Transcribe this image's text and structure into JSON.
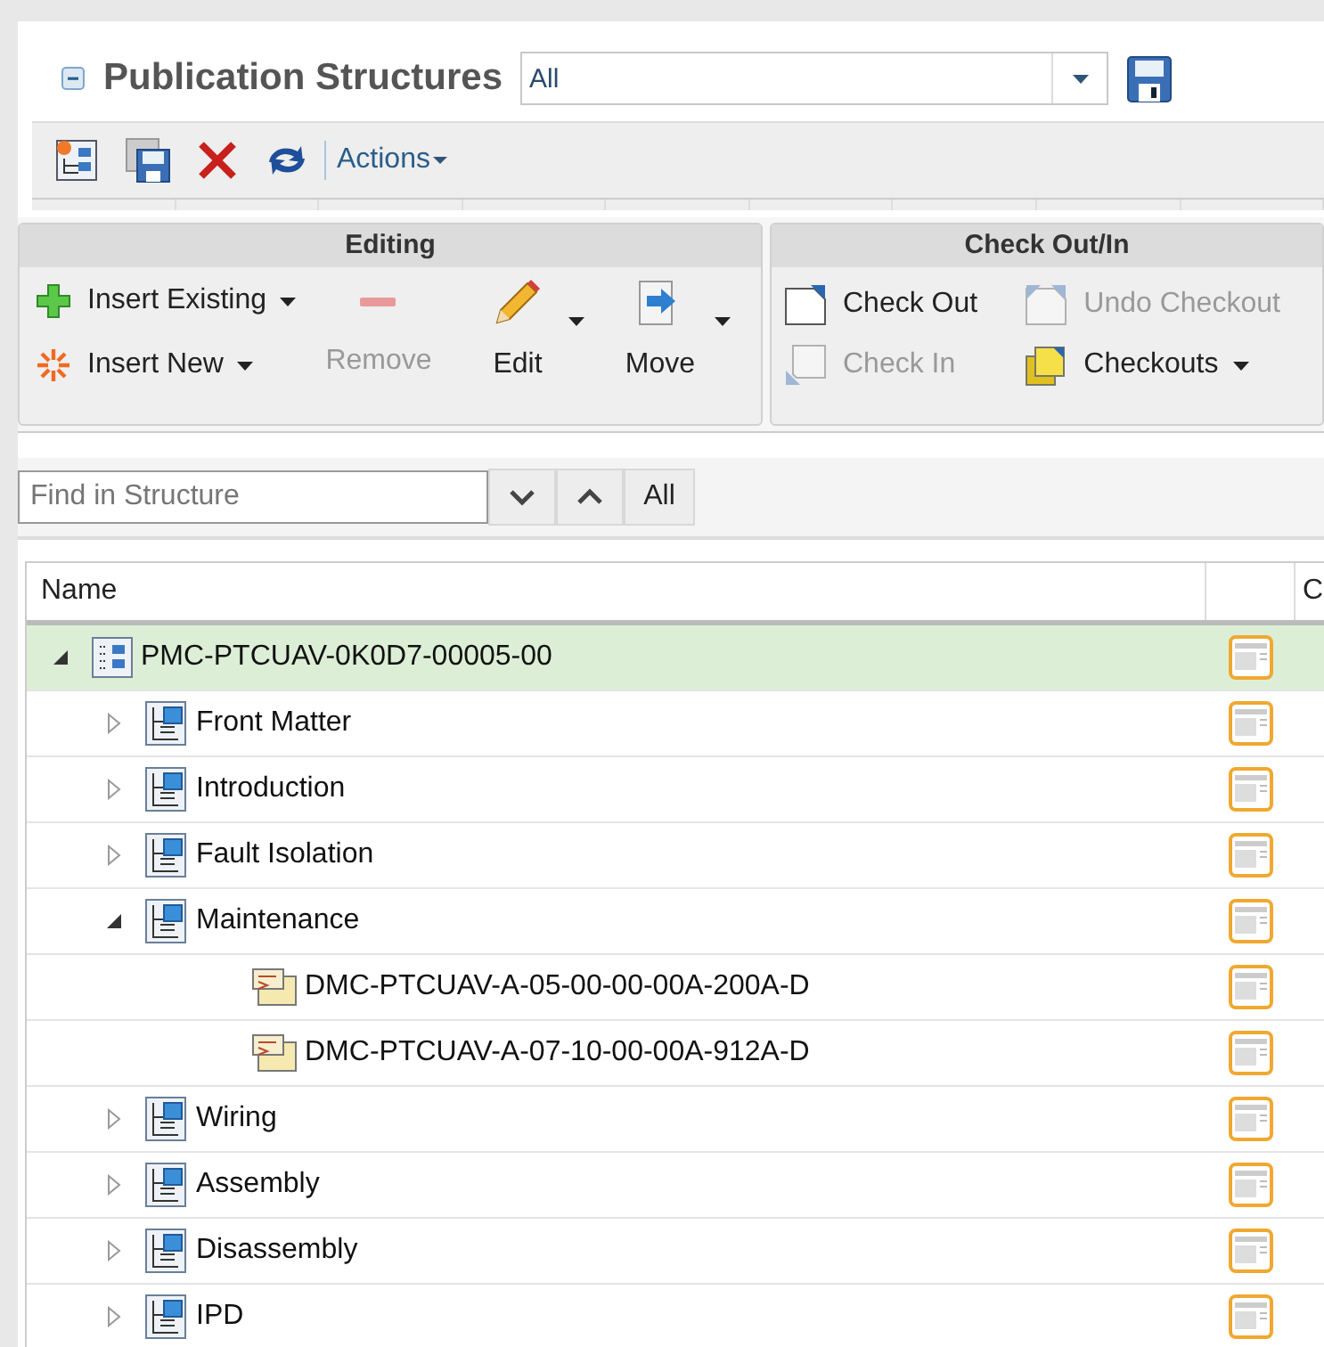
{
  "header": {
    "title": "Publication Structures",
    "filter": {
      "value": "All"
    }
  },
  "toolbar": {
    "actions_label": "Actions"
  },
  "ribbon": {
    "editing": {
      "title": "Editing",
      "insert_existing": {
        "label": "Insert Existing",
        "dropdown": true,
        "disabled": false
      },
      "insert_new": {
        "label": "Insert New",
        "dropdown": true,
        "disabled": false
      },
      "remove": {
        "label": "Remove",
        "dropdown": false,
        "disabled": true
      },
      "edit": {
        "label": "Edit",
        "dropdown": true,
        "disabled": false
      },
      "move": {
        "label": "Move",
        "dropdown": true,
        "disabled": false
      }
    },
    "checkout": {
      "title": "Check Out/In",
      "check_out": {
        "label": "Check Out",
        "disabled": false
      },
      "undo_checkout": {
        "label": "Undo Checkout",
        "disabled": true
      },
      "check_in": {
        "label": "Check In",
        "disabled": true
      },
      "checkouts": {
        "label": "Checkouts",
        "dropdown": true,
        "disabled": false
      }
    }
  },
  "find": {
    "placeholder": "Find in Structure",
    "all_label": "All"
  },
  "table": {
    "columns": [
      "Name",
      "",
      "C"
    ],
    "tree": [
      {
        "name": "PMC-PTCUAV-0K0D7-00005-00",
        "kind": "publication",
        "expanded": true,
        "selected": true,
        "children": [
          {
            "name": "Front Matter",
            "kind": "section",
            "expanded": false,
            "selected": false
          },
          {
            "name": "Introduction",
            "kind": "section",
            "expanded": false,
            "selected": false
          },
          {
            "name": "Fault Isolation",
            "kind": "section",
            "expanded": false,
            "selected": false
          },
          {
            "name": "Maintenance",
            "kind": "section",
            "expanded": true,
            "selected": false,
            "children": [
              {
                "name": "DMC-PTCUAV-A-05-00-00-00A-200A-D",
                "kind": "module",
                "selected": false
              },
              {
                "name": "DMC-PTCUAV-A-07-10-00-00A-912A-D",
                "kind": "module",
                "selected": false
              }
            ]
          },
          {
            "name": "Wiring",
            "kind": "section",
            "expanded": false,
            "selected": false
          },
          {
            "name": "Assembly",
            "kind": "section",
            "expanded": false,
            "selected": false
          },
          {
            "name": "Disassembly",
            "kind": "section",
            "expanded": false,
            "selected": false
          },
          {
            "name": "IPD",
            "kind": "section",
            "expanded": false,
            "selected": false
          }
        ]
      }
    ]
  }
}
